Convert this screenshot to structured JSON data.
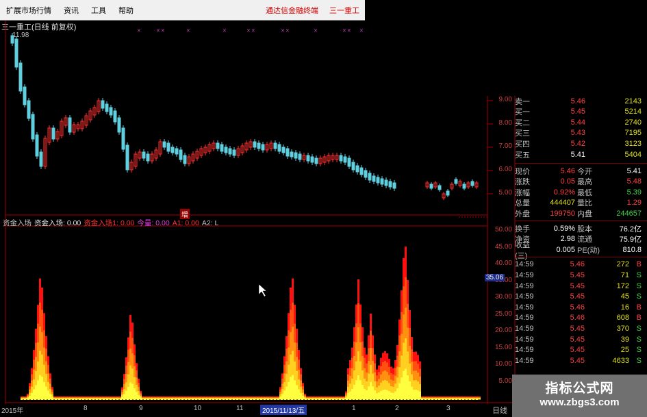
{
  "menu": {
    "items": [
      "扩展市场行情",
      "资讯",
      "工具",
      "帮助"
    ],
    "links": [
      "通达信金融终端",
      "三一重工"
    ]
  },
  "chart": {
    "title": "三一重工(日线 前复权)",
    "high_label": "11.98",
    "indicator_header": [
      {
        "text": "资金入场",
        "color": "#c0c0c0"
      },
      {
        "text": "资金入场: 0.00",
        "color": "#e0e0e0"
      },
      {
        "text": "资金入场1: 0.00",
        "color": "#ff3030"
      },
      {
        "text": "今量: 0.00",
        "color": "#e040e0"
      },
      {
        "text": "A1: 0.00",
        "color": "#ff3030"
      },
      {
        "text": "A2: L",
        "color": "#c0c0c0"
      }
    ],
    "zeng_label": "增",
    "price_axis": [
      "9.00",
      "8.00",
      "7.00",
      "6.00",
      "5.00"
    ],
    "ind_axis": [
      "50.00",
      "45.00",
      "40.00",
      "35.00",
      "30.00",
      "25.00",
      "20.00",
      "15.00",
      "10.00",
      "5.00"
    ],
    "cursor_value": "35.06",
    "dates": [
      {
        "label": "2015年",
        "sel": false
      },
      {
        "label": "8",
        "sel": false
      },
      {
        "label": "9",
        "sel": false
      },
      {
        "label": "10",
        "sel": false
      },
      {
        "label": "11",
        "sel": false
      },
      {
        "label": "2015/11/13/五",
        "sel": true
      },
      {
        "label": "1",
        "sel": false
      },
      {
        "label": "2",
        "sel": false
      },
      {
        "label": "3",
        "sel": false
      }
    ],
    "axis_label": "日线"
  },
  "panel": {
    "quotes": [
      {
        "label": "卖一",
        "price": "5.46",
        "vol": "2143",
        "pc": "red"
      },
      {
        "label": "买一",
        "price": "5.45",
        "vol": "5214",
        "pc": "red"
      },
      {
        "label": "买二",
        "price": "5.44",
        "vol": "2740",
        "pc": "red"
      },
      {
        "label": "买三",
        "price": "5.43",
        "vol": "7195",
        "pc": "red"
      },
      {
        "label": "买四",
        "price": "5.42",
        "vol": "3123",
        "pc": "red"
      },
      {
        "label": "买五",
        "price": "5.41",
        "vol": "5404",
        "pc": "white"
      }
    ],
    "stats": [
      {
        "l1": "现价",
        "v1": "5.46",
        "c1": "red",
        "l2": "今开",
        "v2": "5.41",
        "c2": "white"
      },
      {
        "l1": "涨跌",
        "v1": "0.05",
        "c1": "red",
        "l2": "最高",
        "v2": "5.48",
        "c2": "red"
      },
      {
        "l1": "涨幅",
        "v1": "0.92%",
        "c1": "red",
        "l2": "最低",
        "v2": "5.39",
        "c2": "green"
      },
      {
        "l1": "总量",
        "v1": "444407",
        "c1": "yellow",
        "l2": "量比",
        "v2": "1.29",
        "c2": "red"
      },
      {
        "l1": "外盘",
        "v1": "199750",
        "c1": "red",
        "l2": "内盘",
        "v2": "244657",
        "c2": "green"
      }
    ],
    "stats2": [
      {
        "l1": "换手",
        "v1": "0.59%",
        "c1": "white",
        "l2": "股本",
        "v2": "76.2亿",
        "c2": "white"
      },
      {
        "l1": "净资",
        "v1": "2.98",
        "c1": "white",
        "l2": "流通",
        "v2": "75.9亿",
        "c2": "white"
      },
      {
        "l1": "收益(三)",
        "v1": "0.005",
        "c1": "white",
        "l2": "PE(动)",
        "v2": "810.8",
        "c2": "white"
      }
    ],
    "ticks": [
      {
        "t": "14:59",
        "p": "5.46",
        "v": "272",
        "s": "B",
        "vc": "yellow"
      },
      {
        "t": "14:59",
        "p": "5.45",
        "v": "71",
        "s": "S",
        "vc": "yellow"
      },
      {
        "t": "14:59",
        "p": "5.45",
        "v": "172",
        "s": "S",
        "vc": "yellow"
      },
      {
        "t": "14:59",
        "p": "5.45",
        "v": "45",
        "s": "S",
        "vc": "yellow"
      },
      {
        "t": "14:59",
        "p": "5.46",
        "v": "16",
        "s": "B",
        "vc": "yellow"
      },
      {
        "t": "14:59",
        "p": "5.46",
        "v": "608",
        "s": "B",
        "vc": "magenta"
      },
      {
        "t": "14:59",
        "p": "5.45",
        "v": "370",
        "s": "S",
        "vc": "yellow"
      },
      {
        "t": "14:59",
        "p": "5.45",
        "v": "39",
        "s": "S",
        "vc": "yellow"
      },
      {
        "t": "14:59",
        "p": "5.45",
        "v": "25",
        "s": "S",
        "vc": "yellow"
      },
      {
        "t": "14:59",
        "p": "5.45",
        "v": "4633",
        "s": "S",
        "vc": "magenta"
      }
    ]
  },
  "watermark": {
    "line1": "指标公式网",
    "line2": "www.zbgs3.com"
  }
}
